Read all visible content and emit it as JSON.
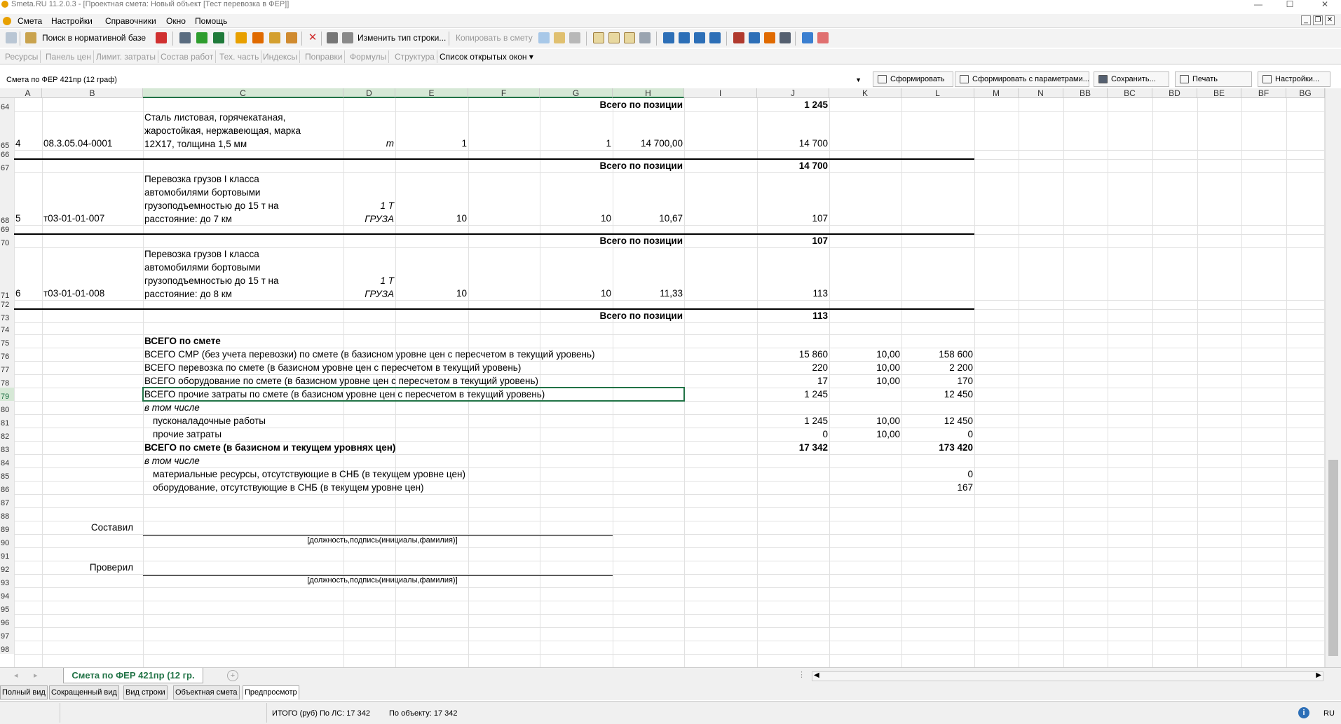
{
  "window": {
    "title": "Smeta.RU  11.2.0.3  - [Проектная смета: Новый объект [Тест перевозка в ФЕР]]",
    "minimize": "—",
    "maximize": "☐",
    "close": "✕"
  },
  "menu": {
    "items": [
      "Смета",
      "Настройки",
      "Справочники",
      "Окно",
      "Помощь"
    ]
  },
  "toolbar": {
    "search_label": "Поиск в нормативной базе",
    "change_row_type_label": "Изменить тип строки...",
    "copy_to_estimate_label": "Копировать в смету"
  },
  "tabs": {
    "items": [
      "Ресурсы",
      "Панель цен",
      "Лимит. затраты",
      "Состав работ",
      "Тех. часть",
      "Индексы",
      "Поправки",
      "Формулы",
      "Структура",
      "Список открытых окон"
    ],
    "dropdown_arrow": "▾"
  },
  "form": {
    "combo_value": "Смета по ФЕР 421пр (12 граф)",
    "combo_arrow": "▼",
    "btn_form": "Сформировать",
    "btn_form_params": "Сформировать с параметрами...",
    "btn_save": "Сохранить...",
    "btn_print": "Печать",
    "btn_settings": "Настройки..."
  },
  "columns": [
    "A",
    "B",
    "C",
    "D",
    "E",
    "F",
    "G",
    "H",
    "I",
    "J",
    "K",
    "L",
    "M",
    "N",
    "BB",
    "BC",
    "BD",
    "BE",
    "BF",
    "BG"
  ],
  "rows": [
    {
      "n": "64",
      "c": {
        "H": "Всего по позиции",
        "J": "1 245"
      }
    },
    {
      "n": "65",
      "c": {
        "A": "4",
        "B": "08.3.05.04-0001",
        "C": [
          "Сталь листовая, горячекатаная,",
          "жаростойкая, нержавеющая, марка",
          "12Х17, толщина 1,5 мм"
        ],
        "D": "т",
        "E": "1",
        "G": "1",
        "H": "14 700,00",
        "J": "14 700"
      }
    },
    {
      "n": "66",
      "c": {}
    },
    {
      "n": "67",
      "c": {
        "H": "Всего по позиции",
        "J": "14 700"
      }
    },
    {
      "n": "68",
      "c": {
        "A": "5",
        "B": "т03-01-01-007",
        "C": [
          "Перевозка грузов I класса",
          "автомобилями бортовыми",
          "грузоподъемностью до 15 т на",
          "расстояние: до 7 км"
        ],
        "D": [
          "1 Т",
          "ГРУЗА"
        ],
        "E": "10",
        "G": "10",
        "H": "10,67",
        "J": "107"
      }
    },
    {
      "n": "69",
      "c": {}
    },
    {
      "n": "70",
      "c": {
        "H": "Всего по позиции",
        "J": "107"
      }
    },
    {
      "n": "71",
      "c": {
        "A": "6",
        "B": "т03-01-01-008",
        "C": [
          "Перевозка грузов I класса",
          "автомобилями бортовыми",
          "грузоподъемностью до 15 т на",
          "расстояние: до 8 км"
        ],
        "D": [
          "1 Т",
          "ГРУЗА"
        ],
        "E": "10",
        "G": "10",
        "H": "11,33",
        "J": "113"
      }
    },
    {
      "n": "72",
      "c": {}
    },
    {
      "n": "73",
      "c": {
        "H": "Всего по позиции",
        "J": "113"
      }
    },
    {
      "n": "74",
      "c": {}
    },
    {
      "n": "75",
      "c": {
        "C": "ВСЕГО по смете"
      }
    },
    {
      "n": "76",
      "c": {
        "C": "ВСЕГО СМР (без учета перевозки) по смете (в базисном уровне цен с пересчетом в текущий уровень)",
        "J": "15 860",
        "K": "10,00",
        "L": "158 600"
      }
    },
    {
      "n": "77",
      "c": {
        "C": "ВСЕГО перевозка по смете (в базисном уровне цен с пересчетом в текущий уровень)",
        "J": "220",
        "K": "10,00",
        "L": "2 200"
      }
    },
    {
      "n": "78",
      "c": {
        "C": "ВСЕГО оборудование по смете (в базисном уровне цен с пересчетом в текущий уровень)",
        "J": "17",
        "K": "10,00",
        "L": "170"
      }
    },
    {
      "n": "79",
      "c": {
        "C": "ВСЕГО прочие затраты по смете (в базисном уровне цен с пересчетом в текущий уровень)",
        "J": "1 245",
        "L": "12 450"
      }
    },
    {
      "n": "80",
      "c": {
        "C": "в том числе"
      }
    },
    {
      "n": "81",
      "c": {
        "C": "пусконаладочные работы",
        "J": "1 245",
        "K": "10,00",
        "L": "12 450"
      }
    },
    {
      "n": "82",
      "c": {
        "C": "прочие затраты",
        "J": "0",
        "K": "10,00",
        "L": "0"
      }
    },
    {
      "n": "83",
      "c": {
        "C": "ВСЕГО по смете (в базисном и текущем уровнях цен)",
        "J": "17 342",
        "L": "173 420"
      }
    },
    {
      "n": "84",
      "c": {
        "C": "в том числе"
      }
    },
    {
      "n": "85",
      "c": {
        "C": "материальные ресурсы, отсутствующие в СНБ (в текущем уровне цен)",
        "L": "0"
      }
    },
    {
      "n": "86",
      "c": {
        "C": "оборудование, отсутствующие в СНБ (в текущем уровне цен)",
        "L": "167"
      }
    },
    {
      "n": "87",
      "c": {}
    },
    {
      "n": "88",
      "c": {}
    },
    {
      "n": "89",
      "c": {
        "B": "Составил"
      }
    },
    {
      "n": "90",
      "c": {
        "C": "[должность,подпись(инициалы,фамилия)]"
      }
    },
    {
      "n": "91",
      "c": {}
    },
    {
      "n": "92",
      "c": {
        "B": "Проверил"
      }
    },
    {
      "n": "93",
      "c": {
        "C": "[должность,подпись(инициалы,фамилия)]"
      }
    },
    {
      "n": "94",
      "c": {}
    },
    {
      "n": "95",
      "c": {}
    },
    {
      "n": "96",
      "c": {}
    },
    {
      "n": "97",
      "c": {}
    },
    {
      "n": "98",
      "c": {}
    }
  ],
  "sheet_tab": "Смета по ФЕР 421пр (12 гр.",
  "view_tabs": [
    "Полный вид",
    "Сокращенный вид",
    "Вид строки",
    "Объектная смета",
    "Предпросмотр"
  ],
  "status": {
    "total": "ИТОГО (руб)  По ЛС: 17 342",
    "by_object": "По объекту: 17 342",
    "lang": "RU",
    "info_icon": "i"
  },
  "colors": {
    "accent": "#217346",
    "selected_header": "#d6e8d6",
    "icon_orange": "#e8a000",
    "icon_green": "#2e9d2e",
    "icon_red": "#d03030",
    "icon_blue": "#2d6fb7"
  }
}
